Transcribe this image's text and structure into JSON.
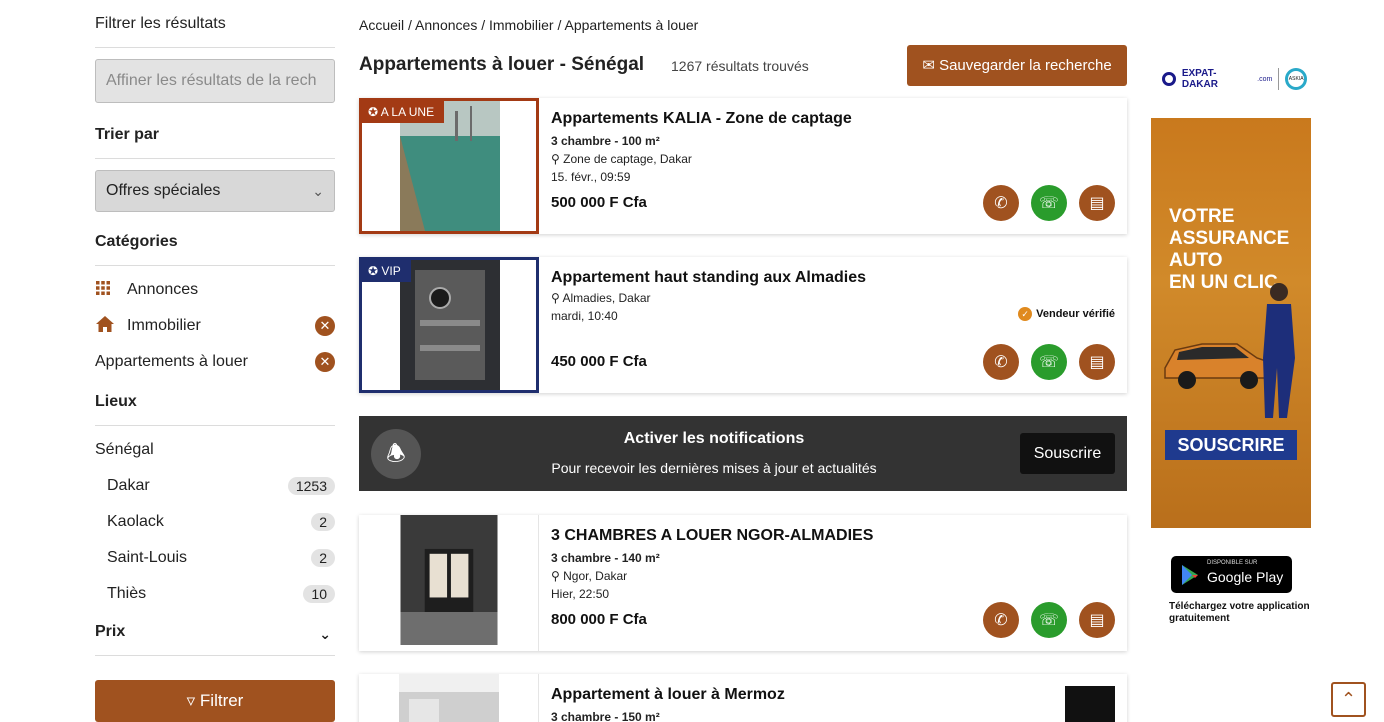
{
  "sidebar": {
    "filter_heading": "Filtrer les résultats",
    "search_placeholder": "Affiner les résultats de la rech",
    "sort_heading": "Trier par",
    "sort_value": "Offres spéciales",
    "categories_heading": "Catégories",
    "categories": [
      {
        "label": "Annonces",
        "icon": "grid-icon"
      },
      {
        "label": "Immobilier",
        "icon": "house-icon"
      },
      {
        "label": "Appartements à louer"
      }
    ],
    "locations_heading": "Lieux",
    "country": "Sénégal",
    "cities": [
      {
        "name": "Dakar",
        "count": "1253"
      },
      {
        "name": "Kaolack",
        "count": "2"
      },
      {
        "name": "Saint-Louis",
        "count": "2"
      },
      {
        "name": "Thiès",
        "count": "10"
      }
    ],
    "price_heading": "Prix",
    "filter_button": "Filtrer"
  },
  "breadcrumb": [
    "Accueil",
    "Annonces",
    "Immobilier",
    "Appartements à louer"
  ],
  "main": {
    "title": "Appartements à louer - Sénégal",
    "results": "1267 résultats trouvés",
    "save_button": "Sauvegarder la recherche"
  },
  "listings": [
    {
      "tag": "A LA UNE",
      "title": "Appartements KALIA - Zone de captage",
      "sub": "3 chambre - 100 m²",
      "location": "Zone de captage, Dakar",
      "date": "15. févr., 09:59",
      "price": "500 000 F Cfa"
    },
    {
      "tag": "VIP",
      "title": "Appartement haut standing aux Almadies",
      "location": "Almadies, Dakar",
      "date": "mardi, 10:40",
      "verified": "Vendeur vérifié",
      "price": "450 000 F Cfa"
    },
    {
      "title": "3 CHAMBRES A LOUER NGOR-ALMADIES",
      "sub": "3 chambre - 140 m²",
      "location": "Ngor, Dakar",
      "date": "Hier, 22:50",
      "price": "800 000 F Cfa"
    },
    {
      "title": "Appartement à louer à Mermoz",
      "sub": "3 chambre - 150 m²"
    }
  ],
  "notification": {
    "title": "Activer les notifications",
    "subtitle": "Pour recevoir les dernières mises à jour et actualités",
    "button": "Souscrire"
  },
  "ads": {
    "brand": "EXPAT-DAKAR",
    "brand_tld": ".com",
    "partner": "ASKIA",
    "banner_lines": [
      "VOTRE",
      "ASSURANCE",
      "AUTO",
      "EN UN CLIC"
    ],
    "banner_button": "SOUSCRIRE",
    "gplay_small": "DISPONIBLE SUR",
    "gplay_big": "Google Play",
    "gplay_caption": "Téléchargez votre application gratuitement"
  },
  "colors": {
    "accent": "#a0521f",
    "une_tag": "#a33a14",
    "vip_tag": "#1f2e6e",
    "whatsapp": "#2a9c2c",
    "notif_bg": "#333333"
  }
}
